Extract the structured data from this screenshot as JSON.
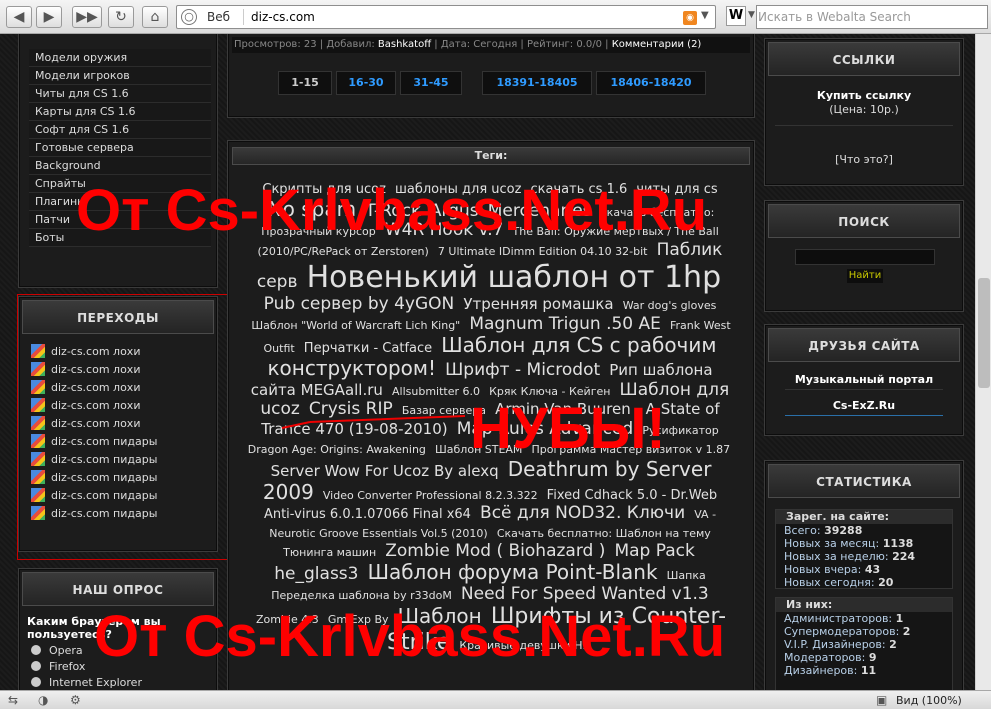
{
  "browser": {
    "search_engine_label": "Веб",
    "url": "diz-cs.com",
    "search_placeholder": "Искать в Webalta Search",
    "zoom_label": "Вид (100%)"
  },
  "meta_line": {
    "views": "Просмотров: 23 | Добавил: ",
    "author": "Bashkatoff",
    "rest": " | Дата: Сегодня | Рейтинг: 0.0/0 | ",
    "comments": "Комментарии (2)"
  },
  "pagination": [
    "1-15",
    "16-30",
    "31-45",
    "18391-18405",
    "18406-18420"
  ],
  "left_menu": [
    "Модели оружия",
    "Модели игроков",
    "Читы для CS 1.6",
    "Карты для CS 1.6",
    "Софт для CS 1.6",
    "Готовые сервера",
    "Background",
    "Спрайты",
    "Плагины",
    "Патчи",
    "Боты"
  ],
  "transitions": {
    "title": "ПЕРЕХОДЫ",
    "items": [
      "diz-cs.com лохи",
      "diz-cs.com лохи",
      "diz-cs.com лохи",
      "diz-cs.com лохи",
      "diz-cs.com лохи",
      "diz-cs.com пидары",
      "diz-cs.com пидары",
      "diz-cs.com пидары",
      "diz-cs.com пидары",
      "diz-cs.com пидары"
    ]
  },
  "poll": {
    "title": "НАШ ОПРОС",
    "question": "Каким браузером вы пользуетесь?",
    "options": [
      "Opera",
      "Firefox",
      "Internet Explorer"
    ]
  },
  "tags": {
    "title": "Теги:",
    "items": [
      {
        "t": "Скрипты для ucoz",
        "s": "t12"
      },
      {
        "t": "шаблоны для ucoz",
        "s": "t12"
      },
      {
        "t": "скачать cs 1.6",
        "s": "t12"
      },
      {
        "t": "читы для cs",
        "s": "t12"
      },
      {
        "t": "No spam",
        "s": "t20"
      },
      {
        "t": "T-Rock",
        "s": "t16"
      },
      {
        "t": "Argus",
        "s": "t16"
      },
      {
        "t": "Mercenaries",
        "s": "t16"
      },
      {
        "t": "скачать бесплатно: Прозрачный курсор",
        "s": "t10"
      },
      {
        "t": "W4R Hook v.7",
        "s": "t16"
      },
      {
        "t": "The Ball: Оружие мертвых / The Ball (2010/PC/RePack от Zerstoren)",
        "s": "t10"
      },
      {
        "t": "7 Ultimate IDimm Edition 04.10 32-bit",
        "s": "t10"
      },
      {
        "t": "Паблик серв",
        "s": "t16"
      },
      {
        "t": "Новенький шаблон от 1hp",
        "s": "t30"
      },
      {
        "t": "Pub сервер by 4yGON",
        "s": "t16"
      },
      {
        "t": "Утренняя ромашка",
        "s": "t14"
      },
      {
        "t": "War dog's gloves",
        "s": "t10"
      },
      {
        "t": "Шаблон \"World of Warcraft Lich King\"",
        "s": "t10"
      },
      {
        "t": "Magnum Trigun .50 AE",
        "s": "t16"
      },
      {
        "t": "Frank West Outfit",
        "s": "t10"
      },
      {
        "t": "Перчатки - Catface",
        "s": "t12"
      },
      {
        "t": "Шаблон для CS с рабочим конструктором!",
        "s": "t20"
      },
      {
        "t": "Шрифт - Microdot",
        "s": "t16"
      },
      {
        "t": "Рип шаблона сайта MEGAall.ru",
        "s": "t14"
      },
      {
        "t": "Allsubmitter 6.0",
        "s": "t10"
      },
      {
        "t": "Кряк Ключа - Кейген",
        "s": "t10"
      },
      {
        "t": "Шаблон для ucoz",
        "s": "t16"
      },
      {
        "t": "Crysis RIP",
        "s": "t16"
      },
      {
        "t": "Базар сервера",
        "s": "t10"
      },
      {
        "t": "Armin Van Buuren - A State of Trance 470 (19-08-2010)",
        "s": "t14"
      },
      {
        "t": "Map Rules Advanced",
        "s": "t16"
      },
      {
        "t": "Русификатор Dragon Age: Origins: Awakening",
        "s": "t10"
      },
      {
        "t": "Шаблон STEAM",
        "s": "t10"
      },
      {
        "t": "Программа Мастер визиток v 1.87",
        "s": "t10"
      },
      {
        "t": "Server Wow For Ucoz By alexq",
        "s": "t14"
      },
      {
        "t": "Deathrum by Server 2009",
        "s": "t20"
      },
      {
        "t": "Video Converter Professional 8.2.3.322",
        "s": "t10"
      },
      {
        "t": "Fixed Cdhack 5.0 - Dr.Web Anti-virus 6.0.1.07066 Final x64",
        "s": "t12"
      },
      {
        "t": "Всё для NOD32. Ключи",
        "s": "t16"
      },
      {
        "t": "VA - Neurotic Groove Essentials Vol.5 (2010)",
        "s": "t10"
      },
      {
        "t": "Скачать бесплатно: Шаблон на тему Тюнинга машин",
        "s": "t10"
      },
      {
        "t": "Zombie Mod ( Biohazard )",
        "s": "t16"
      },
      {
        "t": "Map Pack",
        "s": "t16"
      },
      {
        "t": "he_glass3",
        "s": "t16"
      },
      {
        "t": "Шаблон форума Point-Blank",
        "s": "t20"
      },
      {
        "t": "Шапка",
        "s": "t10"
      },
      {
        "t": "Переделка шаблона by r33doM",
        "s": "t10"
      },
      {
        "t": "Need For Speed Wanted v1.3",
        "s": "t16"
      },
      {
        "t": "Zombie 4.3",
        "s": "t10"
      },
      {
        "t": "Gm Exp By",
        "s": "t10"
      },
      {
        "t": "Шаблон",
        "s": "t20"
      },
      {
        "t": "Шрифты из Counter-Strike",
        "s": "t24"
      },
      {
        "t": "Красивые девушки HD",
        "s": "t10"
      }
    ]
  },
  "links": {
    "title": "ССЫЛКИ",
    "buy": "Купить ссылку",
    "price": "(Цена: 10р.)",
    "what": "[Что это?]"
  },
  "search_box": {
    "title": "ПОИСК",
    "button": "Найти"
  },
  "friends": {
    "title": "ДРУЗЬЯ САЙТА",
    "items": [
      "Музыкальный портал",
      "Cs-ExZ.Ru"
    ]
  },
  "stats": {
    "title": "СТАТИСТИКА",
    "reg_head": "Зарег. на сайте:",
    "reg": [
      {
        "label": "Всего: ",
        "value": "39288"
      },
      {
        "label": "Новых за месяц: ",
        "value": "1138"
      },
      {
        "label": "Новых за неделю: ",
        "value": "224"
      },
      {
        "label": "Новых вчера: ",
        "value": "43"
      },
      {
        "label": "Новых сегодня: ",
        "value": "20"
      }
    ],
    "them_head": "Из них:",
    "them": [
      {
        "label": "Администраторов: ",
        "value": "1"
      },
      {
        "label": "Супермодераторов: ",
        "value": "2"
      },
      {
        "label": "V.I.P. Дизайнеров: ",
        "value": "2"
      },
      {
        "label": "Модераторов: ",
        "value": "9"
      },
      {
        "label": "Дизайнеров: ",
        "value": "11"
      }
    ]
  },
  "watermarks": {
    "top": "От Cs-Krlvbass.Net.Ru",
    "middle": "НУБЫ!",
    "bottom": "От Cs-Krlvbass.Net.Ru"
  }
}
